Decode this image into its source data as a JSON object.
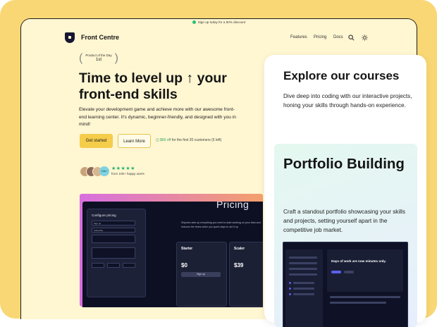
{
  "promo": {
    "text": "Sign up today for a 50% discount"
  },
  "nav": {
    "brand": "Front Centre",
    "links": [
      "Features",
      "Pricing",
      "Docs"
    ],
    "icons": [
      "search-icon",
      "sun-icon"
    ]
  },
  "award": {
    "line1": "Product of the Day",
    "line2": "1st"
  },
  "hero": {
    "title": "Time to level up ↑ your front-end skills",
    "description": "Elevate your development game and achieve more with our awesome front-end learning center. It's dynamic, beginner-friendly, and designed with you in mind!",
    "cta_primary": "Get started",
    "cta_secondary": "Learn More",
    "offer_highlight": "$50 off",
    "offer_rest": "for the first 20 customers (5 left)",
    "avatar_count": "10k+",
    "stars": "★★★★★",
    "happy_users": "from 10k+ happy users"
  },
  "preview": {
    "config_title": "Configure pricing",
    "fields": [
      "Sign up",
      "Subscribe"
    ],
    "heading": "Pricing",
    "subtext": "Shipwim sets up everything you need to start working on your idea and reduces the times when you spent days to set it up",
    "plans": [
      {
        "name": "Starter",
        "price": "$0",
        "button": "Sign up"
      },
      {
        "name": "Scaler",
        "price": "$39",
        "button": ""
      }
    ]
  },
  "card": {
    "title": "Explore our courses",
    "description": "Dive deep into coding with our interactive projects, honing your skills through hands-on experience.",
    "sub_title": "Portfolio Building",
    "sub_description": "Craft a standout portfolio showcasing your skills and projects, setting yourself apart in the competitive job market.",
    "mini_headline": "Days of work are now minutes only."
  }
}
